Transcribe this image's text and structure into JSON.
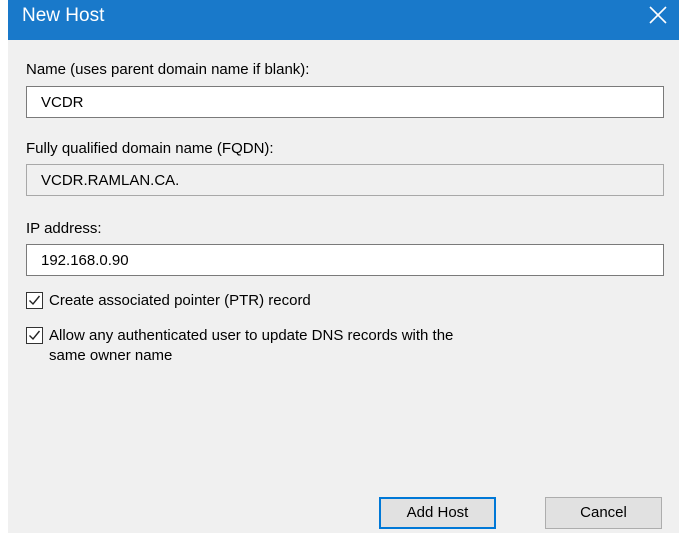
{
  "window": {
    "title": "New Host",
    "accent_color": "#1979ca"
  },
  "form": {
    "name_label": "Name (uses parent domain name if blank):",
    "name_value": "VCDR",
    "fqdn_label": "Fully qualified domain name (FQDN):",
    "fqdn_value": "VCDR.RAMLAN.CA.",
    "ip_label": "IP address:",
    "ip_value": "192.168.0.90",
    "ptr_checkbox": {
      "label": "Create associated pointer (PTR) record",
      "checked": true
    },
    "auth_checkbox": {
      "label_line1": "Allow any authenticated user to update DNS records with the",
      "label_line2": "same owner name",
      "checked": true
    }
  },
  "buttons": {
    "add_host": "Add Host",
    "cancel": "Cancel"
  },
  "icons": {
    "close": "close-icon",
    "checkmark": "checkmark-icon"
  }
}
